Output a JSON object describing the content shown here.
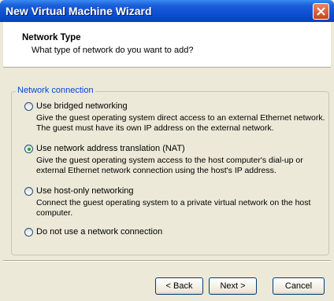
{
  "window": {
    "title": "New Virtual Machine Wizard"
  },
  "header": {
    "title": "Network Type",
    "subtitle": "What type of network do you want to add?"
  },
  "group": {
    "label": "Network connection",
    "options": [
      {
        "label": "Use bridged networking",
        "desc": "Give the guest operating system direct access to an external Ethernet network. The guest must have its own IP address on the external network.",
        "selected": false
      },
      {
        "label": "Use network address translation (NAT)",
        "desc": "Give the guest operating system access to the host computer's dial-up or external Ethernet network connection using the host's IP address.",
        "selected": true
      },
      {
        "label": "Use host-only networking",
        "desc": "Connect the guest operating system to a private virtual network on the host computer.",
        "selected": false
      },
      {
        "label": "Do not use a network connection",
        "desc": "",
        "selected": false
      }
    ]
  },
  "buttons": {
    "back": "< Back",
    "next": "Next >",
    "cancel": "Cancel"
  }
}
